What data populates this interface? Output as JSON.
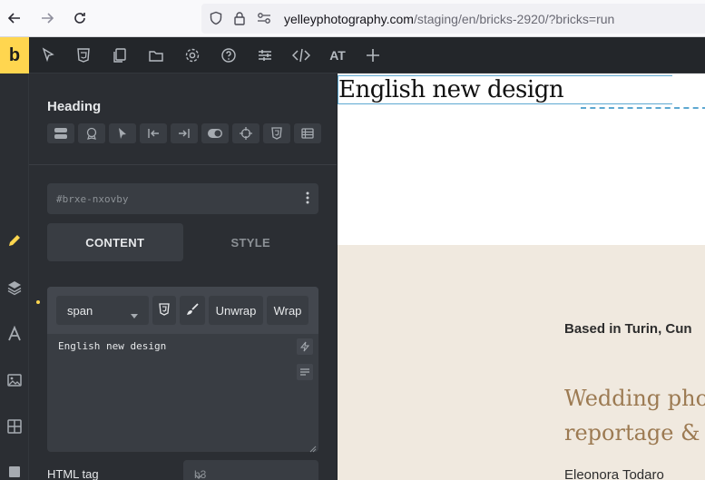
{
  "browser": {
    "url_domain": "yelleyphotography.com",
    "url_path": "/staging/en/bricks-2920/?bricks=run"
  },
  "toolbar": {
    "logo": "b",
    "at_label": "AT"
  },
  "panel": {
    "title": "Heading",
    "element_id": "#brxe-nxovby",
    "tabs": [
      {
        "label": "CONTENT",
        "active": true
      },
      {
        "label": "STYLE",
        "active": false
      }
    ],
    "rich_text": {
      "tag_select": "span",
      "buttons": [
        "Unwrap",
        "Wrap"
      ],
      "content": "English new design"
    },
    "html_tag": {
      "label": "HTML tag",
      "value": "h3"
    }
  },
  "canvas": {
    "heading": "English new design",
    "based": "Based in Turin, Cun",
    "big_line1": "Wedding pho",
    "big_line2": "reportage &",
    "author": "Eleonora Todaro"
  },
  "colors": {
    "accent": "#ffd64f",
    "panel_bg": "#2b2e33",
    "canvas_beige": "#f0e9df",
    "title_brown": "#9c7a52",
    "selection_blue": "#5ea8d1"
  }
}
